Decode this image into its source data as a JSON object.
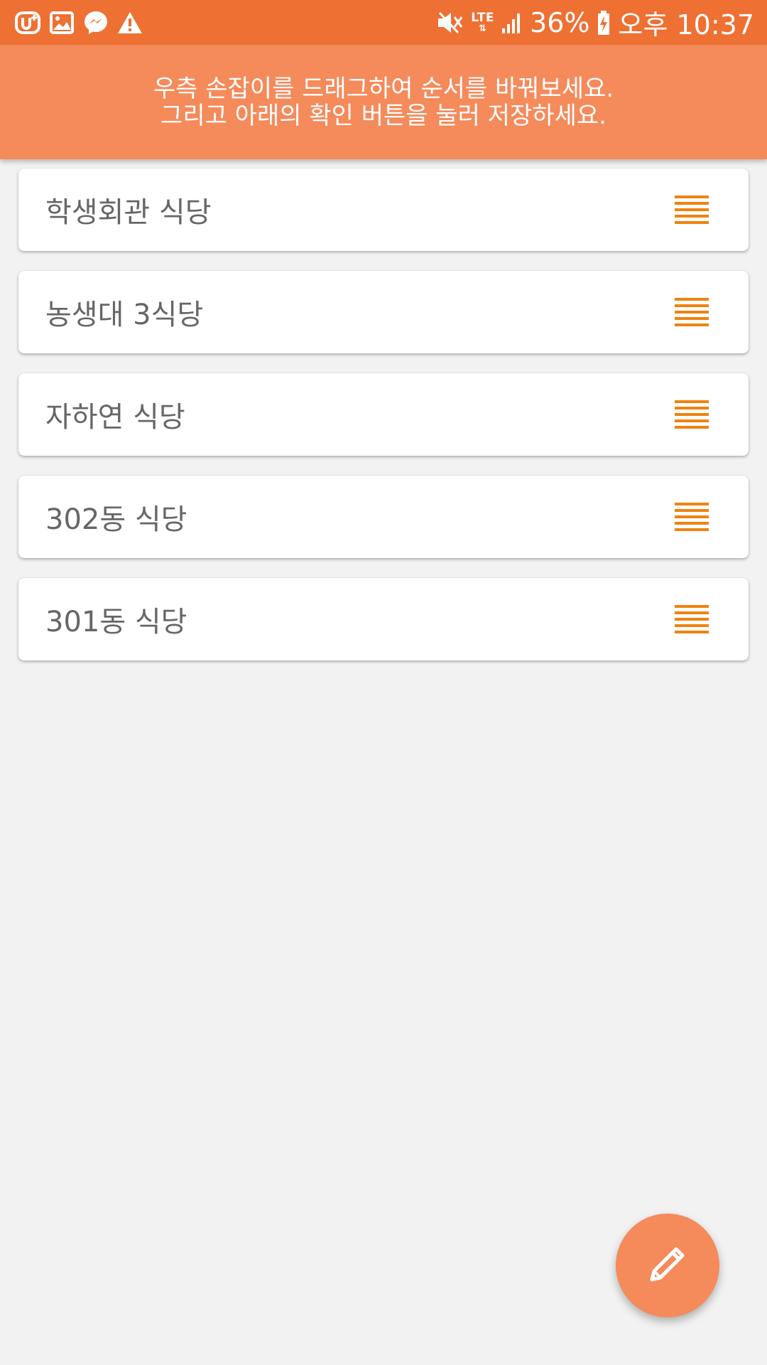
{
  "status_bar": {
    "left_icons": [
      "u-plus-icon",
      "image-icon",
      "messenger-icon",
      "warning-icon"
    ],
    "right_icons": [
      "mute-icon",
      "lte-icon",
      "signal-icon",
      "battery-charging-icon"
    ],
    "lte_label": "LTE",
    "battery_percent": "36%",
    "time": "오후 10:37"
  },
  "banner": {
    "line1": "우측 손잡이를 드래그하여 순서를 바꿔보세요.",
    "line2": "그리고 아래의 확인 버튼을 눌러 저장하세요."
  },
  "list": {
    "items": [
      {
        "label": "학생회관 식당"
      },
      {
        "label": "농생대 3식당"
      },
      {
        "label": "자하연 식당"
      },
      {
        "label": "302동 식당"
      },
      {
        "label": "301동 식당"
      }
    ]
  },
  "fab": {
    "icon": "pencil-icon"
  },
  "colors": {
    "status_bar": "#ee7033",
    "banner": "#f58a5b",
    "handle": "#f0820f",
    "background": "#f2f2f2",
    "item_text": "#666666"
  }
}
